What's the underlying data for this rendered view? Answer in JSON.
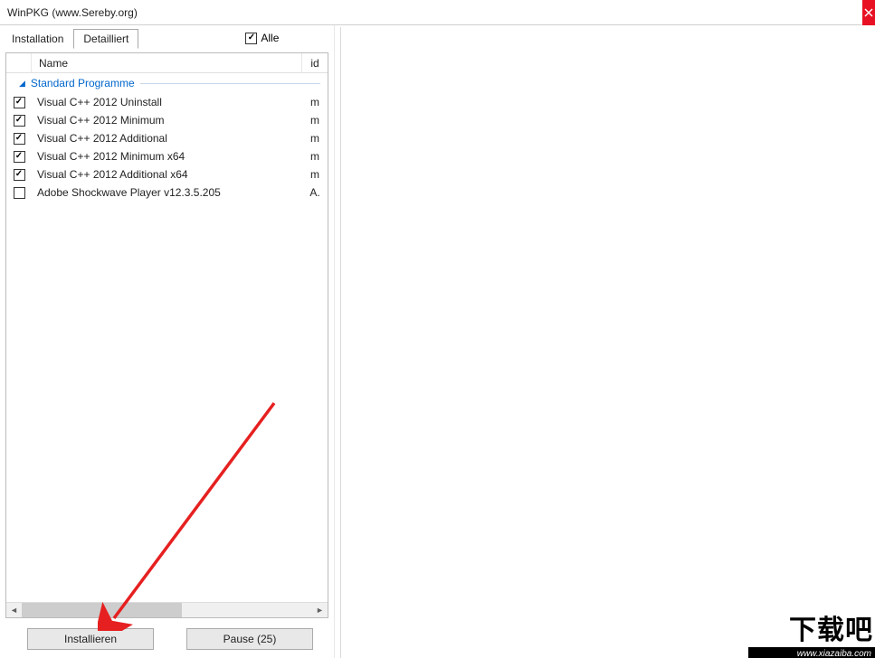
{
  "window": {
    "title": "WinPKG (www.Sereby.org)"
  },
  "tabs": {
    "installation": "Installation",
    "detailliert": "Detailliert"
  },
  "alle": {
    "label": "Alle",
    "checked": true
  },
  "columns": {
    "name": "Name",
    "id": "id"
  },
  "group": {
    "title": "Standard Programme"
  },
  "items": [
    {
      "checked": true,
      "name": "Visual C++ 2012 Uninstall",
      "id": "m"
    },
    {
      "checked": true,
      "name": "Visual C++ 2012 Minimum",
      "id": "m"
    },
    {
      "checked": true,
      "name": "Visual C++ 2012 Additional",
      "id": "m"
    },
    {
      "checked": true,
      "name": "Visual C++ 2012 Minimum x64",
      "id": "m"
    },
    {
      "checked": true,
      "name": "Visual C++ 2012 Additional x64",
      "id": "m"
    },
    {
      "checked": false,
      "name": "Adobe Shockwave Player v12.3.5.205",
      "id": "A."
    }
  ],
  "buttons": {
    "install": "Installieren",
    "pause": "Pause (25)"
  },
  "watermark": {
    "main": "下载吧",
    "sub": "www.xiazaiba.com"
  }
}
